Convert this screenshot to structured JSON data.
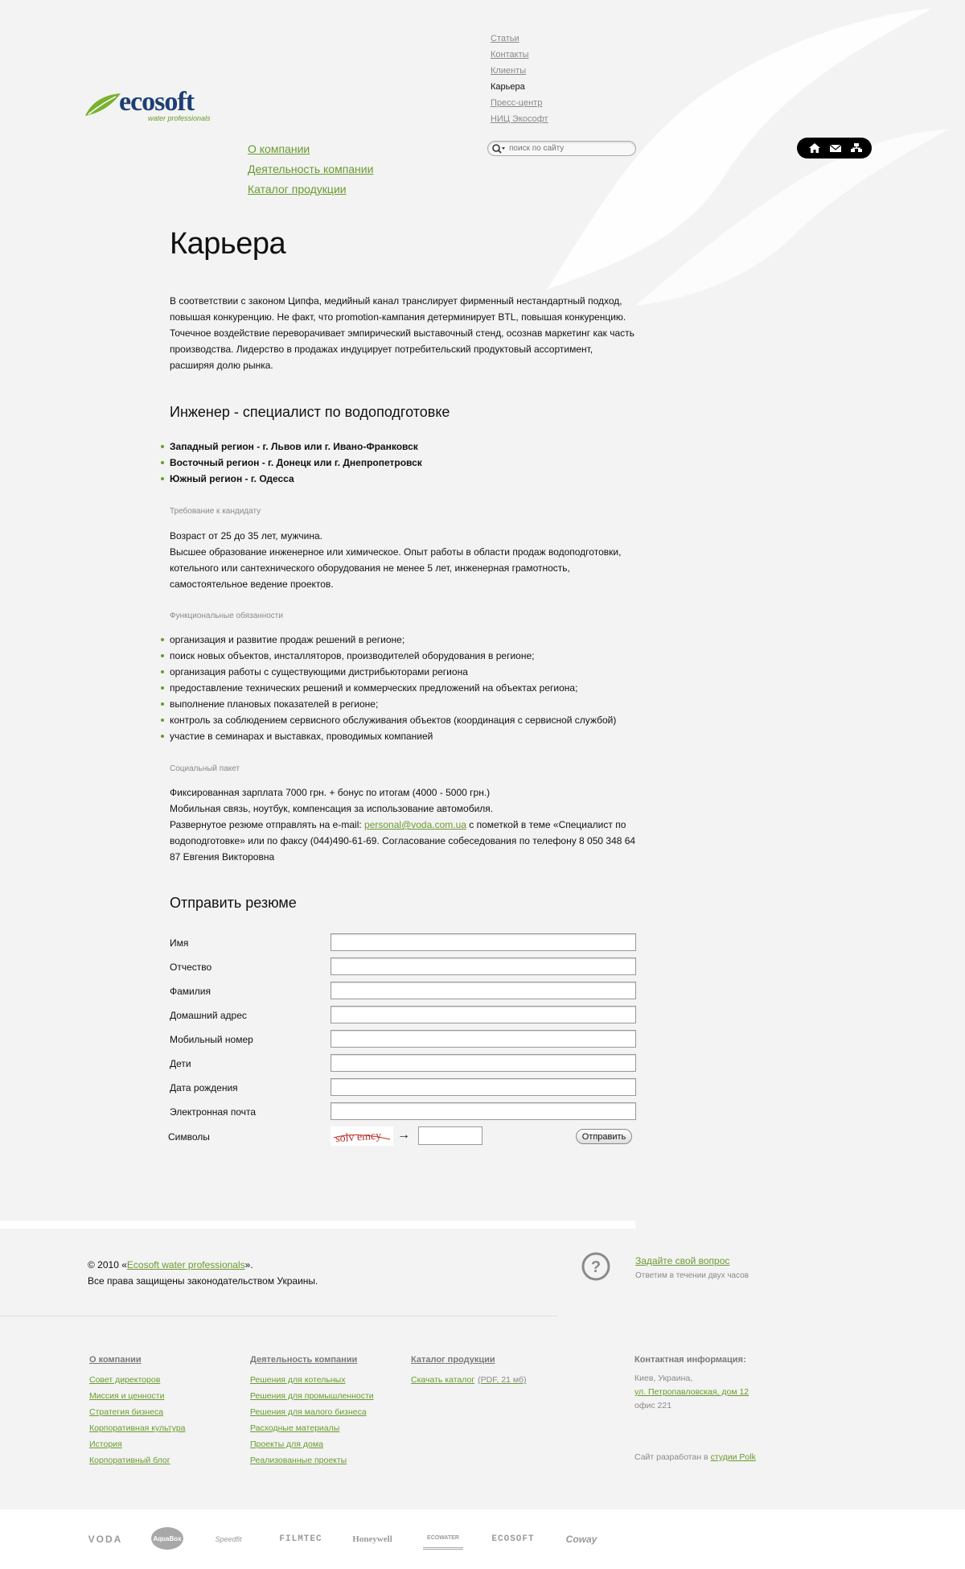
{
  "logo": {
    "word": "ecosoft",
    "tagline": "water professionals"
  },
  "top_nav": [
    {
      "label": "Статьи",
      "current": false
    },
    {
      "label": "Контакты",
      "current": false
    },
    {
      "label": "Клиенты",
      "current": false
    },
    {
      "label": "Карьера",
      "current": true
    },
    {
      "label": "Пресс-центр",
      "current": false
    },
    {
      "label": "НИЦ Экософт",
      "current": false
    }
  ],
  "main_nav": [
    "О компании",
    "Деятельность компании",
    "Каталог продукции"
  ],
  "search": {
    "placeholder": "поиск по сайту"
  },
  "icon_bar": [
    "home-icon",
    "mail-icon",
    "sitemap-icon"
  ],
  "page": {
    "title": "Карьера",
    "intro": "В соответствии с законом Ципфа, медийный канал транслирует фирменный нестандартный подход, повышая конкуренцию. Не факт, что promotion-кампания детерминирует BTL, повышая конкуренцию. Точечное воздействие переворачивает эмпирический выставочный стенд, осознав маркетинг как часть производства. Лидерство в продажах индуцирует потребительский продуктовый ассортимент, расширяя долю рынка.",
    "vacancy_title": "Инженер - специалист по водоподготовке",
    "regions": [
      "Западный регион - г. Львов или г. Ивано-Франковск",
      "Восточный регион - г. Донецк или г. Днепропетровск",
      "Южный регион - г. Одесса"
    ],
    "req_label": "Требование к кандидату",
    "req_text_1": "Возраст от 25 до 35 лет, мужчина.",
    "req_text_2": "Высшее образование инженерное или химическое. Опыт работы в области продаж водоподготовки, котельного или сантехнического оборудования не менее 5 лет, инженерная грамотность, самостоятельное ведение проектов.",
    "duties_label": "Функциональные обязанности",
    "duties": [
      "организация и развитие продаж решений в регионе;",
      "поиск новых объектов, инсталляторов, производителей оборудования в регионе;",
      "организация работы с существующими дистрибьюторами региона",
      "предоставление технических решений и коммерческих предложений на объектах региона;",
      "выполнение плановых показателей в регионе;",
      "контроль за соблюдением сервисного обслуживания объектов (координация с сервисной службой)",
      "участие в семинарах и выставках, проводимых компанией"
    ],
    "social_label": "Социальный пакет",
    "social_1": "Фиксированная зарплата 7000 грн. + бонус по итогам (4000 - 5000 грн.)",
    "social_2": "Мобильная связь, ноутбук, компенсация за использование автомобиля.",
    "resume_before": "Развернутое резюме отправлять на e-mail: ",
    "resume_email": "personal@voda.com.ua",
    "resume_after": " с пометкой в теме «Специалист по водоподготовке» или по факсу (044)490-61-69. Согласование собеседования по телефону 8 050 348 64 87 Евгения Викторовна"
  },
  "form": {
    "title": "Отправить резюме",
    "fields": [
      "Имя",
      "Отчество",
      "Фамилия",
      "Домашний адрес",
      "Мобильный номер",
      "Дети",
      "Дата рождения",
      "Электронная почта"
    ],
    "captcha_label": "Символы",
    "captcha_text": "solv emcy",
    "arrow": "→",
    "submit": "Отправить"
  },
  "footer": {
    "copy_prefix": "© 2010 «",
    "copy_link": "Ecosoft water professionals",
    "copy_suffix": "».",
    "rights": "Все права защищены законодательством Украины.",
    "question_link": "Задайте свой вопрос",
    "question_sub": "Ответим в течении двух часов",
    "col1": {
      "head": "О компании",
      "links": [
        "Совет директоров",
        "Миссия и ценности",
        "Стратегия бизнеса",
        "Корпоративная культура",
        "История",
        "Корпоративный блог"
      ]
    },
    "col2": {
      "head": "Деятельность компании",
      "links": [
        "Решения для котельных",
        "Решения для промышленности",
        "Решения для малого бизнеса",
        "Расходные материалы",
        "Проекты для дома",
        "Реализованные проекты"
      ]
    },
    "col3": {
      "head": "Каталог продукции",
      "link": "Скачать каталог",
      "note": "(PDF, 21 мб)"
    },
    "contact": {
      "head": "Контактная информация:",
      "line1": "Киев, Украина,",
      "address": "ул. Петропавловская, дом 12",
      "line3": "офис 221"
    },
    "dev_prefix": "Сайт разработан в ",
    "dev_link": "студии Polk"
  },
  "partners": [
    "VODA",
    "AquaBox",
    "Speedfit",
    "FILMTEC",
    "Honeywell",
    "ECOWATER",
    "ECOSOFT",
    "Coway"
  ],
  "colors": {
    "accent_green": "#6a9b2e",
    "logo_blue": "#1d3f73",
    "background": "#f3f3f3"
  }
}
